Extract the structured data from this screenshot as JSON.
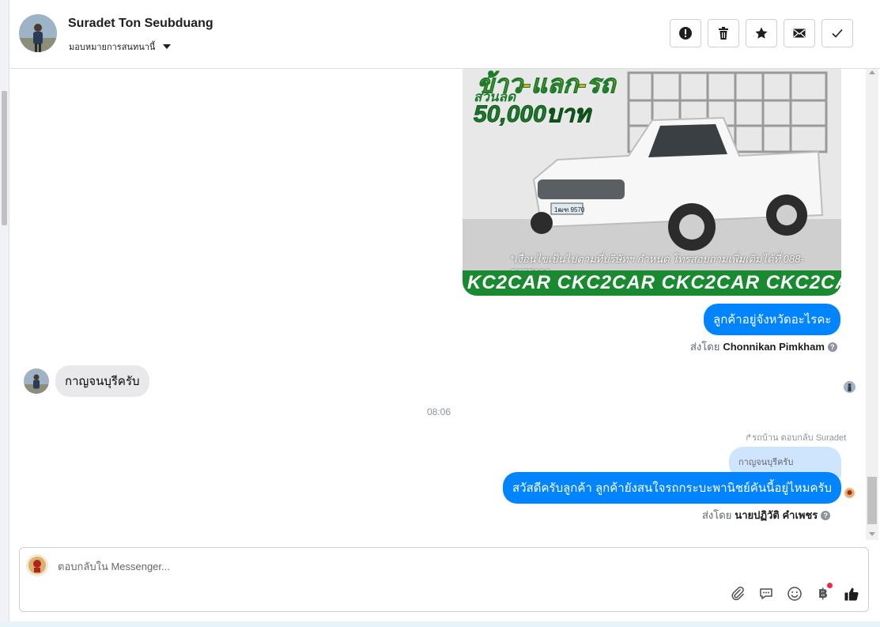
{
  "contact": {
    "name": "Suradet Ton Seubduang",
    "assign_label": "มอบหมายการสนทนานี้"
  },
  "header_actions": [
    {
      "name": "spam-button",
      "icon": "alert-circle-icon"
    },
    {
      "name": "delete-button",
      "icon": "trash-icon"
    },
    {
      "name": "star-button",
      "icon": "star-icon"
    },
    {
      "name": "mark-unread-button",
      "icon": "envelope-icon"
    },
    {
      "name": "mark-done-button",
      "icon": "checkmark-icon"
    }
  ],
  "ad_image": {
    "headline": "ข้าว-แลก-รถ",
    "discount_label": "ส่วนลด",
    "discount_amount": "50,000บาท",
    "fine_print": "*เงื่อนไขเป็นไปตามที่บริษัทฯ กำหนด โทรสอบถามเพิ่มเติมได้ที่ 088-5577932",
    "band_text": "KC2CAR CKC2CAR CKC2CAR CKC2CAR CKC2",
    "plate": "1ฒฑ 9570"
  },
  "messages": {
    "out_1": "ลูกค้าอยู่จังหวัดอะไรคะ",
    "sent_by_1_prefix": "ส่งโดย",
    "sent_by_1_name": "Chonnikan Pimkham",
    "in_1": "กาญจนบุรีครับ",
    "timestamp": "08:06",
    "reply_info": "รถบ้าน ตอบกลับ Suradet",
    "quoted_text": "กาญจนบุรีครับ",
    "out_2": "สวัสดีครับลูกค้า ลูกค้ายังสนใจรถกระบะพานิชย์คันนี้อยู่ไหมครับ",
    "sent_by_2_prefix": "ส่งโดย",
    "sent_by_2_name": "นายปฏิวัติ คำเพชร",
    "help_glyph": "?"
  },
  "composer": {
    "placeholder": "ตอบกลับใน Messenger...",
    "icons": [
      "paperclip-icon",
      "quick-reply-icon",
      "emoji-icon",
      "baht-payment-icon",
      "thumbs-up-icon"
    ],
    "baht_glyph": "฿"
  },
  "colors": {
    "accent": "#0084ff",
    "incoming_bubble": "#e9e9eb",
    "quoted_bubble": "#cfe4fd",
    "ad_band": "#198a2f"
  }
}
